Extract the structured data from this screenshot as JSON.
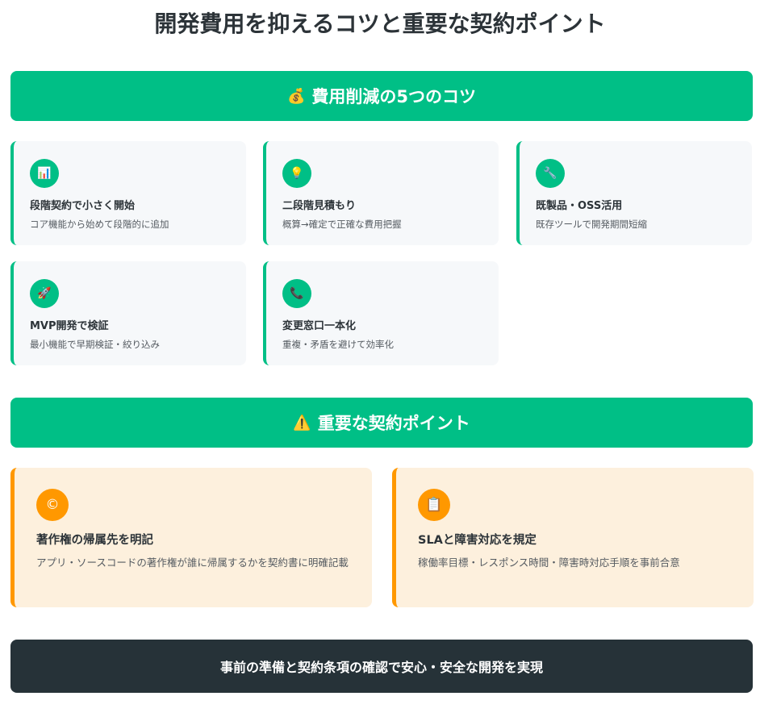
{
  "title": "開発費用を抑えるコツと重要な契約ポイント",
  "tips_section": {
    "icon": "money-bag-icon",
    "icon_glyph": "💰",
    "heading": "費用削減の5つのコツ",
    "accent_color": "#00bf86",
    "items": [
      {
        "icon": "chart-icon",
        "glyph": "📊",
        "title": "段階契約で小さく開始",
        "desc": "コア機能から始めて段階的に追加"
      },
      {
        "icon": "lightbulb-icon",
        "glyph": "💡",
        "title": "二段階見積もり",
        "desc": "概算→確定で正確な費用把握"
      },
      {
        "icon": "wrench-icon",
        "glyph": "🔧",
        "title": "既製品・OSS活用",
        "desc": "既存ツールで開発期間短縮"
      },
      {
        "icon": "rocket-icon",
        "glyph": "🚀",
        "title": "MVP開発で検証",
        "desc": "最小機能で早期検証・絞り込み"
      },
      {
        "icon": "phone-icon",
        "glyph": "📞",
        "title": "変更窓口一本化",
        "desc": "重複・矛盾を避けて効率化"
      }
    ]
  },
  "contract_section": {
    "icon": "warning-icon",
    "icon_glyph": "⚠️",
    "heading": "重要な契約ポイント",
    "accent_color": "#ff9800",
    "items": [
      {
        "icon": "copyright-icon",
        "glyph": "©",
        "title": "著作権の帰属先を明記",
        "desc": "アプリ・ソースコードの著作権が誰に帰属するかを契約書に明確記載"
      },
      {
        "icon": "clipboard-icon",
        "glyph": "📋",
        "title": "SLAと障害対応を規定",
        "desc": "稼働率目標・レスポンス時間・障害時対応手順を事前合意"
      }
    ]
  },
  "footer": {
    "text": "事前の準備と契約条項の確認で安心・安全な開発を実現",
    "background_color": "#263238"
  }
}
